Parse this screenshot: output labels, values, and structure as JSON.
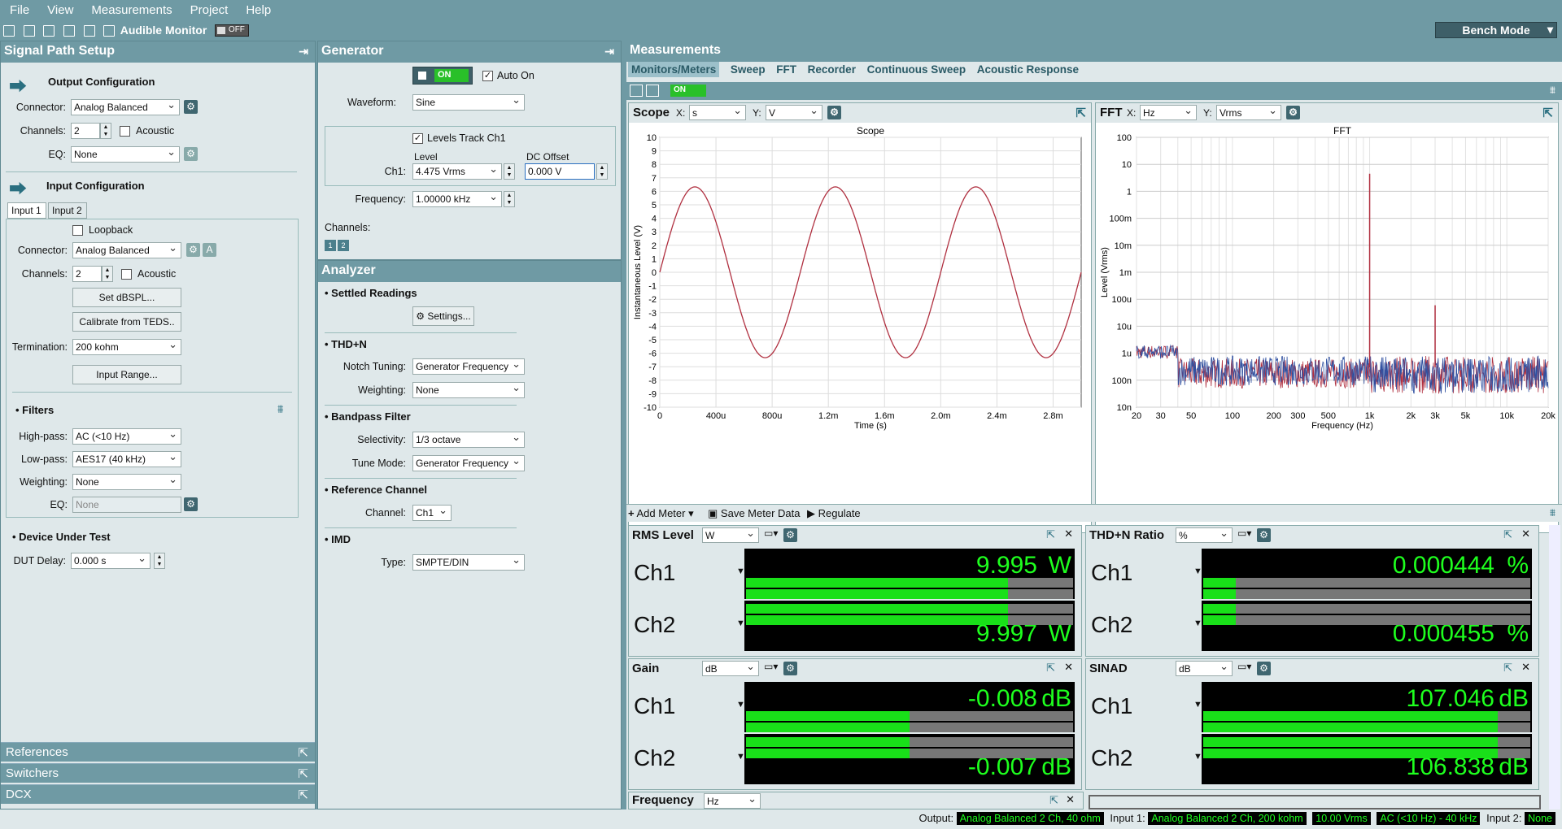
{
  "menu": [
    "File",
    "View",
    "Measurements",
    "Project",
    "Help"
  ],
  "toolbar": {
    "audible_monitor": "Audible Monitor",
    "audible_state": "OFF",
    "bench_mode": "Bench Mode"
  },
  "signal_path": {
    "title": "Signal Path Setup",
    "output": {
      "title": "Output Configuration",
      "connector_label": "Connector:",
      "connector": "Analog Balanced",
      "channels_label": "Channels:",
      "channels": "2",
      "acoustic": "Acoustic",
      "eq_label": "EQ:",
      "eq": "None"
    },
    "input": {
      "title": "Input Configuration",
      "tabs": [
        "Input 1",
        "Input 2"
      ],
      "loopback": "Loopback",
      "connector_label": "Connector:",
      "connector": "Analog Balanced",
      "channels_label": "Channels:",
      "channels": "2",
      "acoustic": "Acoustic",
      "set_dbspl": "Set dBSPL...",
      "calibrate": "Calibrate from TEDS..",
      "termination_label": "Termination:",
      "termination": "200 kohm",
      "input_range": "Input Range..."
    },
    "filters": {
      "title": "Filters",
      "highpass_label": "High-pass:",
      "highpass": "AC (<10 Hz)",
      "lowpass_label": "Low-pass:",
      "lowpass": "AES17 (40 kHz)",
      "weighting_label": "Weighting:",
      "weighting": "None",
      "eq_label": "EQ:",
      "eq": "None"
    },
    "dut": {
      "title": "Device Under Test",
      "delay_label": "DUT Delay:",
      "delay": "0.000 s"
    },
    "bottom": [
      "References",
      "Switchers",
      "DCX"
    ]
  },
  "generator": {
    "title": "Generator",
    "on": "ON",
    "auto_on": "Auto On",
    "waveform_label": "Waveform:",
    "waveform": "Sine",
    "levels_track": "Levels Track Ch1",
    "level_header": "Level",
    "dc_header": "DC Offset",
    "ch1_label": "Ch1:",
    "ch1_level": "4.475 Vrms",
    "ch1_dc": "0.000 V",
    "frequency_label": "Frequency:",
    "frequency": "1.00000 kHz",
    "channels_label": "Channels:",
    "channel_buttons": [
      "1",
      "2"
    ]
  },
  "analyzer": {
    "title": "Analyzer",
    "settled": "Settled Readings",
    "settings": "Settings...",
    "thdn": "THD+N",
    "notch_label": "Notch Tuning:",
    "notch": "Generator Frequency",
    "weighting_label": "Weighting:",
    "weighting": "None",
    "bandpass": "Bandpass Filter",
    "selectivity_label": "Selectivity:",
    "selectivity": "1/3 octave",
    "tune_label": "Tune Mode:",
    "tune": "Generator Frequency",
    "ref": "Reference Channel",
    "channel_label": "Channel:",
    "channel": "Ch1",
    "imd": "IMD",
    "type_label": "Type:",
    "type": "SMPTE/DIN"
  },
  "measurements": {
    "title": "Measurements",
    "tabs": [
      "Monitors/Meters",
      "Sweep",
      "FFT",
      "Recorder",
      "Continuous Sweep",
      "Acoustic Response"
    ],
    "on": "ON",
    "scope": {
      "title": "Scope",
      "x_label": "X:",
      "x_unit": "s",
      "y_label": "Y:",
      "y_unit": "V",
      "graph_title": "Scope",
      "xlabel": "Time (s)",
      "ylabel": "Instantaneous Level (V)"
    },
    "fft": {
      "title": "FFT",
      "x_label": "X:",
      "x_unit": "Hz",
      "y_label": "Y:",
      "y_unit": "Vrms",
      "graph_title": "FFT",
      "xlabel": "Frequency (Hz)",
      "ylabel": "Level (Vrms)"
    },
    "meter_toolbar": {
      "add_meter": "Add Meter",
      "save": "Save Meter Data",
      "regulate": "Regulate"
    },
    "meters": [
      {
        "title": "RMS Level",
        "unit_sel": "W",
        "unit": "W",
        "ch1": "9.995",
        "ch2": "9.997",
        "bar1": 0.8,
        "bar2": 0.8
      },
      {
        "title": "THD+N Ratio",
        "unit_sel": "%",
        "unit": "%",
        "ch1": "0.000444",
        "ch2": "0.000455",
        "bar1": 0.1,
        "bar2": 0.1
      },
      {
        "title": "Gain",
        "unit_sel": "dB",
        "unit": "dB",
        "ch1": "-0.008",
        "ch2": "-0.007",
        "bar1": 0.5,
        "bar2": 0.5
      },
      {
        "title": "SINAD",
        "unit_sel": "dB",
        "unit": "dB",
        "ch1": "107.046",
        "ch2": "106.838",
        "bar1": 0.9,
        "bar2": 0.9
      }
    ],
    "ch_labels": [
      "Ch1",
      "Ch2"
    ],
    "frequency_meter": {
      "title": "Frequency",
      "unit_sel": "Hz"
    }
  },
  "status": {
    "output_label": "Output:",
    "output": "Analog Balanced 2 Ch, 40 ohm",
    "input1_label": "Input 1:",
    "input1": "Analog Balanced 2 Ch, 200 kohm",
    "level": "10.00 Vrms",
    "filter": "AC (<10 Hz) - 40 kHz",
    "input2_label": "Input 2:",
    "input2": "None"
  },
  "chart_data": [
    {
      "type": "line",
      "title": "Scope",
      "xlabel": "Time (s)",
      "ylabel": "Instantaneous Level (V)",
      "xlim": [
        0,
        0.003
      ],
      "ylim": [
        -10,
        10
      ],
      "x_ticks": [
        "0",
        "400u",
        "800u",
        "1.2m",
        "1.6m",
        "2.0m",
        "2.4m",
        "2.8m"
      ],
      "y_ticks": [
        "10",
        "9",
        "8",
        "7",
        "6",
        "5",
        "4",
        "3",
        "2",
        "1",
        "0",
        "-1",
        "-2",
        "-3",
        "-4",
        "-5",
        "-6",
        "-7",
        "-8",
        "-9",
        "-10"
      ],
      "series": [
        {
          "amplitude": 6.33,
          "frequency": 1000,
          "color": "#b03040"
        }
      ]
    },
    {
      "type": "line",
      "title": "FFT",
      "xlabel": "Frequency (Hz)",
      "ylabel": "Level (Vrms)",
      "xscale": "log",
      "yscale": "log",
      "xlim": [
        20,
        20000
      ],
      "ylim": [
        1e-08,
        100
      ],
      "x_ticks": [
        "20",
        "30",
        "50",
        "100",
        "200",
        "300",
        "500",
        "1k",
        "2k",
        "3k",
        "5k",
        "10k",
        "20k"
      ],
      "y_ticks": [
        "100",
        "10",
        "1",
        "100m",
        "10m",
        "1m",
        "100u",
        "10u",
        "1u",
        "100n",
        "10n"
      ],
      "peaks": [
        {
          "x": 1000,
          "y": 4.47
        },
        {
          "x": 3000,
          "y": 6e-05
        }
      ],
      "series": [
        {
          "color": "#b03040"
        },
        {
          "color": "#3050a0"
        }
      ]
    }
  ]
}
